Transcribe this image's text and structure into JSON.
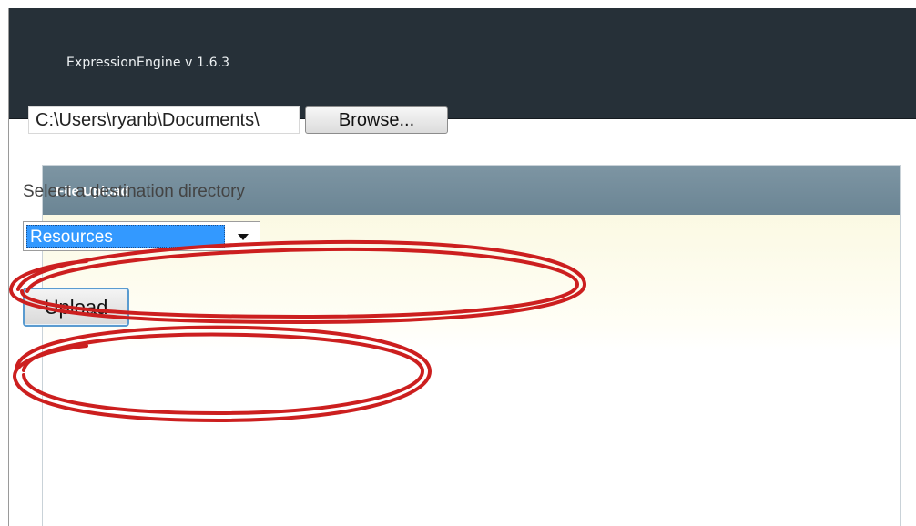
{
  "header": {
    "app_title": "ExpressionEngine  v 1.6.3"
  },
  "panel": {
    "title": "File Upload",
    "file_input": {
      "value": "C:\\Users\\ryanb\\Documents\\",
      "browse_label": "Browse..."
    },
    "destination": {
      "label": "Select a destination directory",
      "selected": "Resources"
    },
    "upload_label": "Upload"
  },
  "annotation_color": "#cc1f1f"
}
